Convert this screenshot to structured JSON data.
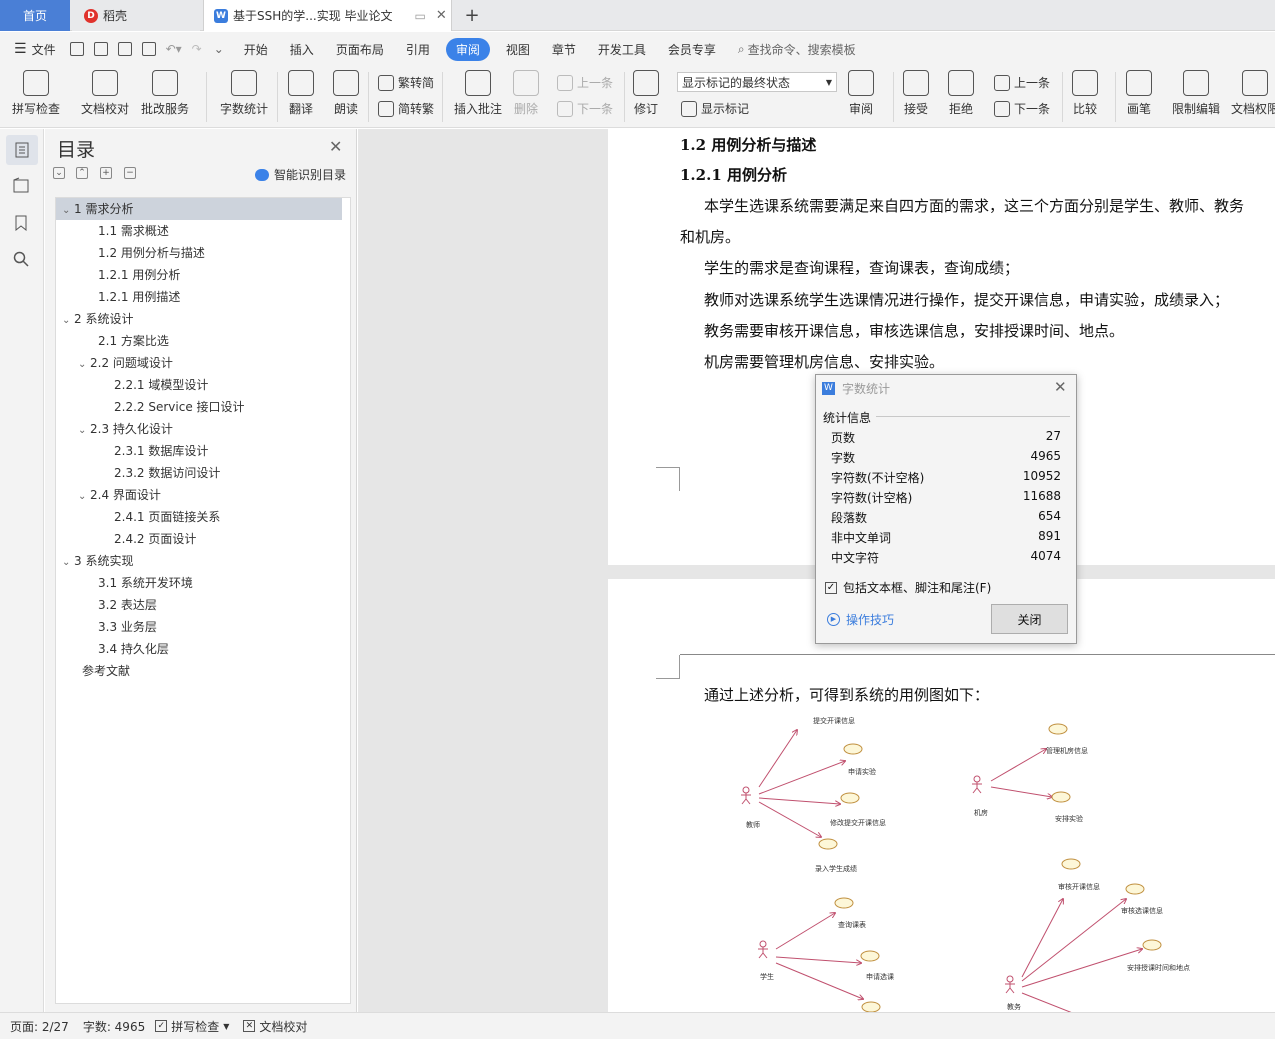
{
  "tabs": {
    "home": "首页",
    "docer": "稻壳",
    "doc": "基于SSH的学...实现 毕业论文"
  },
  "menu": {
    "file": "文件",
    "items": [
      "开始",
      "插入",
      "页面布局",
      "引用",
      "审阅",
      "视图",
      "章节",
      "开发工具",
      "会员专享"
    ],
    "active": "审阅",
    "search": "查找命令、搜索模板"
  },
  "ribbon": {
    "spellcheck": "拼写检查",
    "doc_proof": "文档校对",
    "batch_service": "批改服务",
    "word_count": "字数统计",
    "translate": "翻译",
    "read_aloud": "朗读",
    "to_traditional": "繁转简",
    "to_simplified": "简转繁",
    "insert_comment": "插入批注",
    "delete": "删除",
    "prev_comment": "上一条",
    "next_comment": "下一条",
    "track_changes": "修订",
    "markup_state": "显示标记的最终状态",
    "show_markup": "显示标记",
    "review": "审阅",
    "accept": "接受",
    "reject": "拒绝",
    "prev_change": "上一条",
    "next_change": "下一条",
    "compare": "比较",
    "pen": "画笔",
    "restrict_edit": "限制编辑",
    "doc_permission": "文档权限"
  },
  "nav": {
    "title": "目录",
    "smart_toc": "智能识别目录",
    "toc": [
      {
        "text": "1  需求分析",
        "level": 0,
        "chevron": "expanded",
        "selected": true
      },
      {
        "text": "1.1  需求概述",
        "level": 1
      },
      {
        "text": "1.2  用例分析与描述",
        "level": 1
      },
      {
        "text": "1.2.1  用例分析",
        "level": 1
      },
      {
        "text": "1.2.1  用例描述",
        "level": 1
      },
      {
        "text": "2  系统设计",
        "level": 0,
        "chevron": "expanded"
      },
      {
        "text": "2.1  方案比选",
        "level": 1
      },
      {
        "text": "2.2  问题域设计",
        "level": 1,
        "chevron": "expanded"
      },
      {
        "text": "2.2.1   域模型设计",
        "level": 2
      },
      {
        "text": "2.2.2    Service 接口设计",
        "level": 2
      },
      {
        "text": "2.3  持久化设计",
        "level": 1,
        "chevron": "expanded"
      },
      {
        "text": "2.3.1   数据库设计",
        "level": 2
      },
      {
        "text": "2.3.2  数据访问设计",
        "level": 2
      },
      {
        "text": "2.4  界面设计",
        "level": 1,
        "chevron": "expanded"
      },
      {
        "text": "2.4.1   页面链接关系",
        "level": 2
      },
      {
        "text": "2.4.2   页面设计",
        "level": 2
      },
      {
        "text": "3  系统实现",
        "level": 0,
        "chevron": "expanded"
      },
      {
        "text": "3.1  系统开发环境",
        "level": 1
      },
      {
        "text": "3.2  表达层",
        "level": 1
      },
      {
        "text": "3.3  业务层",
        "level": 1
      },
      {
        "text": "3.4  持久化层",
        "level": 1
      },
      {
        "text": "参考文献",
        "level": 0
      }
    ]
  },
  "document": {
    "h2": "1.2  用例分析与描述",
    "h3": "1.2.1  用例分析",
    "p1": "本学生选课系统需要满足来自四方面的需求，这三个方面分别是学生、教师、教务",
    "p1b": "和机房。",
    "p2": "学生的需求是查询课程，查询课表，查询成绩；",
    "p3": "教师对选课系统学生选课情况进行操作，提交开课信息，申请实验，成绩录入；",
    "p4": "教务需要审核开课信息，审核选课信息，安排授课时间、地点。",
    "p5": "机房需要管理机房信息、安排实验。",
    "p6": "通过上述分析，可得到系统的用例图如下：",
    "diagram": {
      "teacher": "教师",
      "teacher_uc": [
        "提交开课信息",
        "申请实验",
        "修改提交开课信息",
        "录入学生成绩"
      ],
      "lab": "机房",
      "lab_uc": [
        "管理机房信息",
        "安排实验"
      ],
      "student": "学生",
      "student_uc": [
        "查询课表",
        "申请选课"
      ],
      "admin": "教务",
      "admin_uc": [
        "审核开课信息",
        "审核选课信息",
        "安排授课时间和地点"
      ]
    }
  },
  "dialog": {
    "title": "字数统计",
    "group": "统计信息",
    "stats": [
      {
        "label": "页数",
        "value": "27"
      },
      {
        "label": "字数",
        "value": "4965"
      },
      {
        "label": "字符数(不计空格)",
        "value": "10952"
      },
      {
        "label": "字符数(计空格)",
        "value": "11688"
      },
      {
        "label": "段落数",
        "value": "654"
      },
      {
        "label": "非中文单词",
        "value": "891"
      },
      {
        "label": "中文字符",
        "value": "4074"
      }
    ],
    "include_label": "包括文本框、脚注和尾注(F)",
    "include_checked": true,
    "tips": "操作技巧",
    "close": "关闭"
  },
  "status": {
    "page": "页面: 2/27",
    "words": "字数: 4965",
    "spellcheck": "拼写检查",
    "proof": "文档校对"
  },
  "colors": {
    "accent": "#3b82e8",
    "tab_home": "#4a7fd6",
    "actor": "#c0506e",
    "usecase_fill": "#fdf7d8"
  }
}
